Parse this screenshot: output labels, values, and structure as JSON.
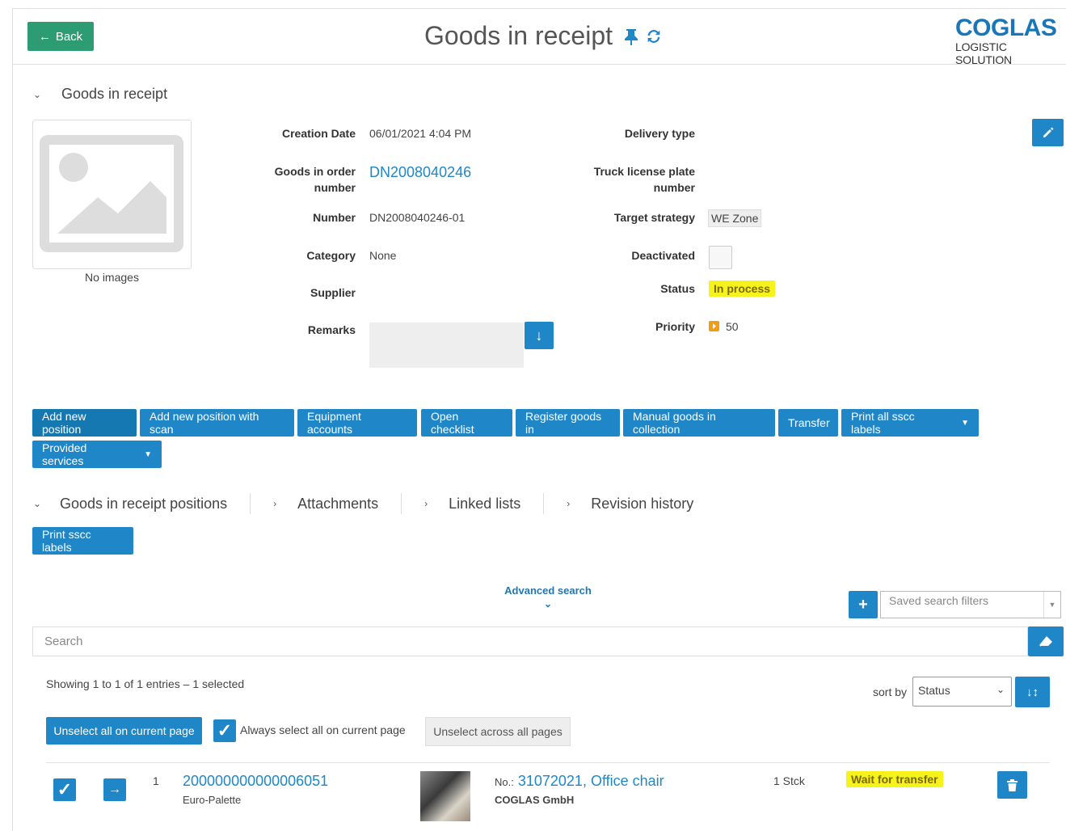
{
  "header": {
    "back_label": "Back",
    "title": "Goods in receipt",
    "logo_brand": "COGLAS",
    "logo_tag": "LOGISTIC SOLUTION"
  },
  "detail": {
    "section_title": "Goods in receipt",
    "no_images": "No images",
    "creation_date_label": "Creation Date",
    "creation_date": "06/01/2021 4:04 PM",
    "order_number_label_1": "Goods in order",
    "order_number_label_2": "number",
    "order_number": "DN2008040246",
    "number_label": "Number",
    "number": "DN2008040246-01",
    "category_label": "Category",
    "category": "None",
    "supplier_label": "Supplier",
    "remarks_label": "Remarks",
    "delivery_type_label": "Delivery type",
    "truck_label_1": "Truck license plate",
    "truck_label_2": "number",
    "target_strategy_label": "Target strategy",
    "target_strategy": "WE Zone",
    "deactivated_label": "Deactivated",
    "status_label": "Status",
    "status": "In process",
    "priority_label": "Priority",
    "priority": "50"
  },
  "actions": [
    "Add new position",
    "Add new position with scan",
    "Equipment accounts",
    "Open checklist",
    "Register goods in",
    "Manual goods in collection",
    "Transfer",
    "Print all sscc labels",
    "Provided services"
  ],
  "tabs": [
    "Goods in receipt positions",
    "Attachments",
    "Linked lists",
    "Revision history"
  ],
  "positions": {
    "print_label": "Print sscc labels",
    "advanced_search": "Advanced search",
    "saved_filters_placeholder": "Saved search filters",
    "search_placeholder": "Search",
    "showing": "Showing 1 to 1 of 1 entries  –  1 selected",
    "sort_by": "sort by",
    "sort_value": "Status",
    "unselect_page": "Unselect all on current page",
    "always_select": "Always select all on current page",
    "unselect_all": "Unselect across all pages"
  },
  "rows": [
    {
      "index": "1",
      "sscc": "200000000000006051",
      "carrier": "Euro-Palette",
      "no_prefix": "No.:",
      "article_no": "31072021,",
      "article_name": "Office chair",
      "company": "COGLAS GmbH",
      "quantity": "1 Stck",
      "status": "Wait for transfer"
    }
  ],
  "colors": {
    "primary": "#1f87c8",
    "back": "#2e9c73",
    "highlight": "#f6f21c",
    "priority": "#f39c12"
  }
}
